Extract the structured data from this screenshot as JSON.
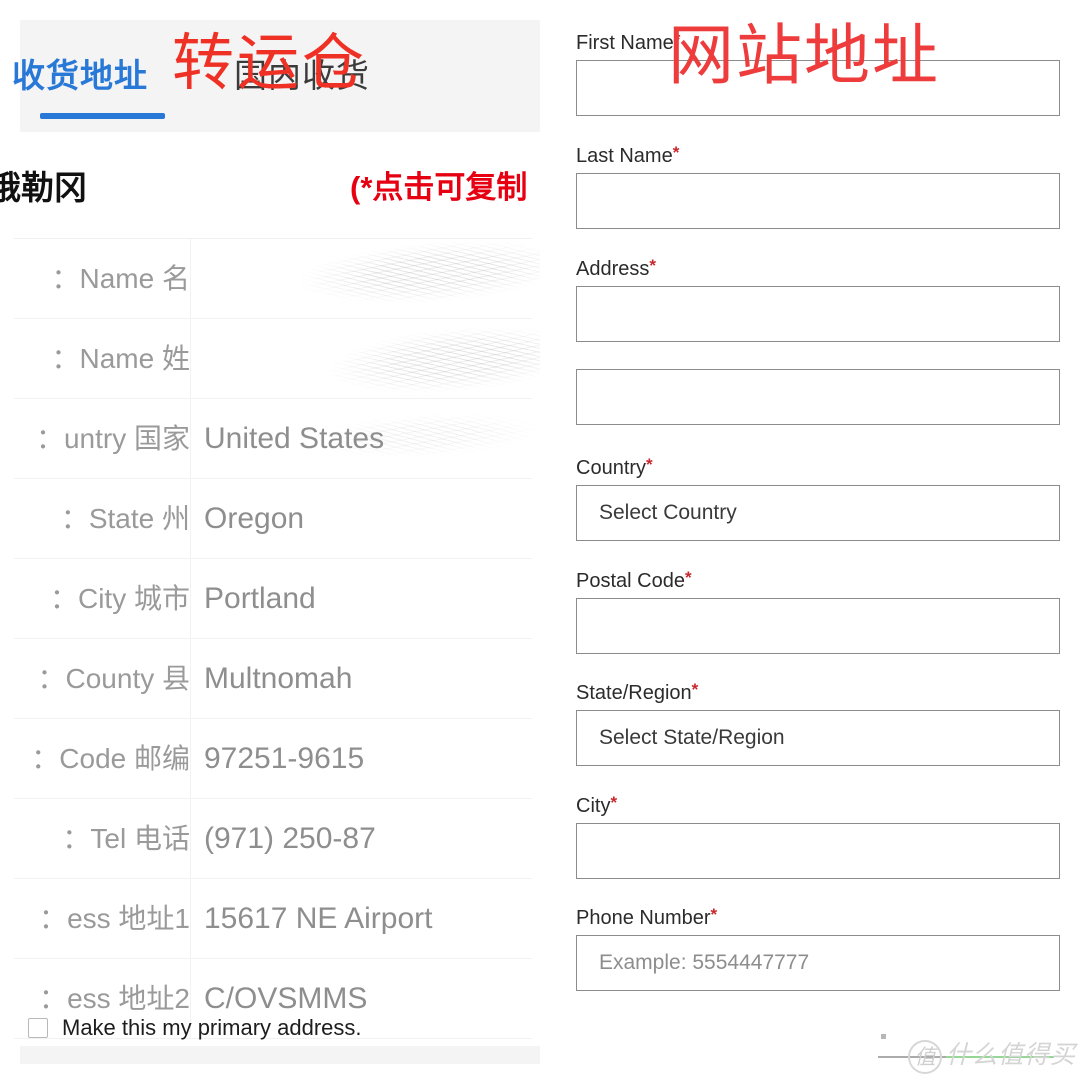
{
  "left_panel": {
    "tabs": [
      {
        "label": "收货地址",
        "active": true,
        "name": "overseas"
      },
      {
        "label": "国内收货",
        "active": false,
        "name": "domestic"
      }
    ],
    "annotation": "转运仓",
    "card_title": "俄勒冈",
    "copy_hint": "(*点击可复制",
    "table": {
      "rows": [
        {
          "label": "Name 名：",
          "value": "",
          "redacted": true
        },
        {
          "label": "Name 姓：",
          "value": "",
          "redacted": true
        },
        {
          "label": "untry 国家：",
          "value": "United States",
          "redacted": false
        },
        {
          "label": "State 州：",
          "value": "Oregon",
          "redacted": false
        },
        {
          "label": "City 城市：",
          "value": "Portland",
          "redacted": false
        },
        {
          "label": "County 县：",
          "value": "Multnomah",
          "redacted": false
        },
        {
          "label": "Code 邮编：",
          "value": "97251-9615",
          "redacted": false
        },
        {
          "label": "Tel 电话：",
          "value": "(971) 250-87",
          "redacted": false
        },
        {
          "label": "ess 地址1：",
          "value": "15617 NE Airport",
          "redacted": false
        },
        {
          "label": "ess 地址2：",
          "value": "C/OVSMMS",
          "redacted": false
        }
      ]
    }
  },
  "right_panel": {
    "annotation": "网站地址",
    "fields": [
      {
        "label": "First Name",
        "required": true,
        "value": "",
        "placeholder": "",
        "kind": "text"
      },
      {
        "label": "Last Name",
        "required": true,
        "value": "",
        "placeholder": "",
        "kind": "text"
      },
      {
        "label": "Address",
        "required": true,
        "value": "",
        "placeholder": "",
        "kind": "text"
      },
      {
        "label": "",
        "required": false,
        "value": "",
        "placeholder": "",
        "kind": "text"
      },
      {
        "label": "Country",
        "required": true,
        "value": "Select Country",
        "placeholder": "",
        "kind": "select"
      },
      {
        "label": "Postal Code",
        "required": true,
        "value": "",
        "placeholder": "",
        "kind": "text"
      },
      {
        "label": "State/Region",
        "required": true,
        "value": "Select State/Region",
        "placeholder": "",
        "kind": "select"
      },
      {
        "label": "City",
        "required": true,
        "value": "",
        "placeholder": "",
        "kind": "text"
      },
      {
        "label": "Phone Number",
        "required": true,
        "value": "",
        "placeholder": "Example: 5554447777",
        "kind": "text"
      }
    ],
    "primary_address_checkbox": {
      "label": "Make this my primary address.",
      "checked": false
    }
  },
  "watermark": {
    "mark": "值",
    "text": "什么值得买"
  },
  "colors": {
    "tab_active": "#2878d8",
    "annotation_red": "#ee3124",
    "hint_red": "#e60012",
    "required_red": "#c8262b",
    "tabstrip_bg": "#f4f4f4",
    "input_border": "#8c8c8c",
    "value_gray": "#8e8e8e",
    "label_gray": "#9a9a9a"
  }
}
